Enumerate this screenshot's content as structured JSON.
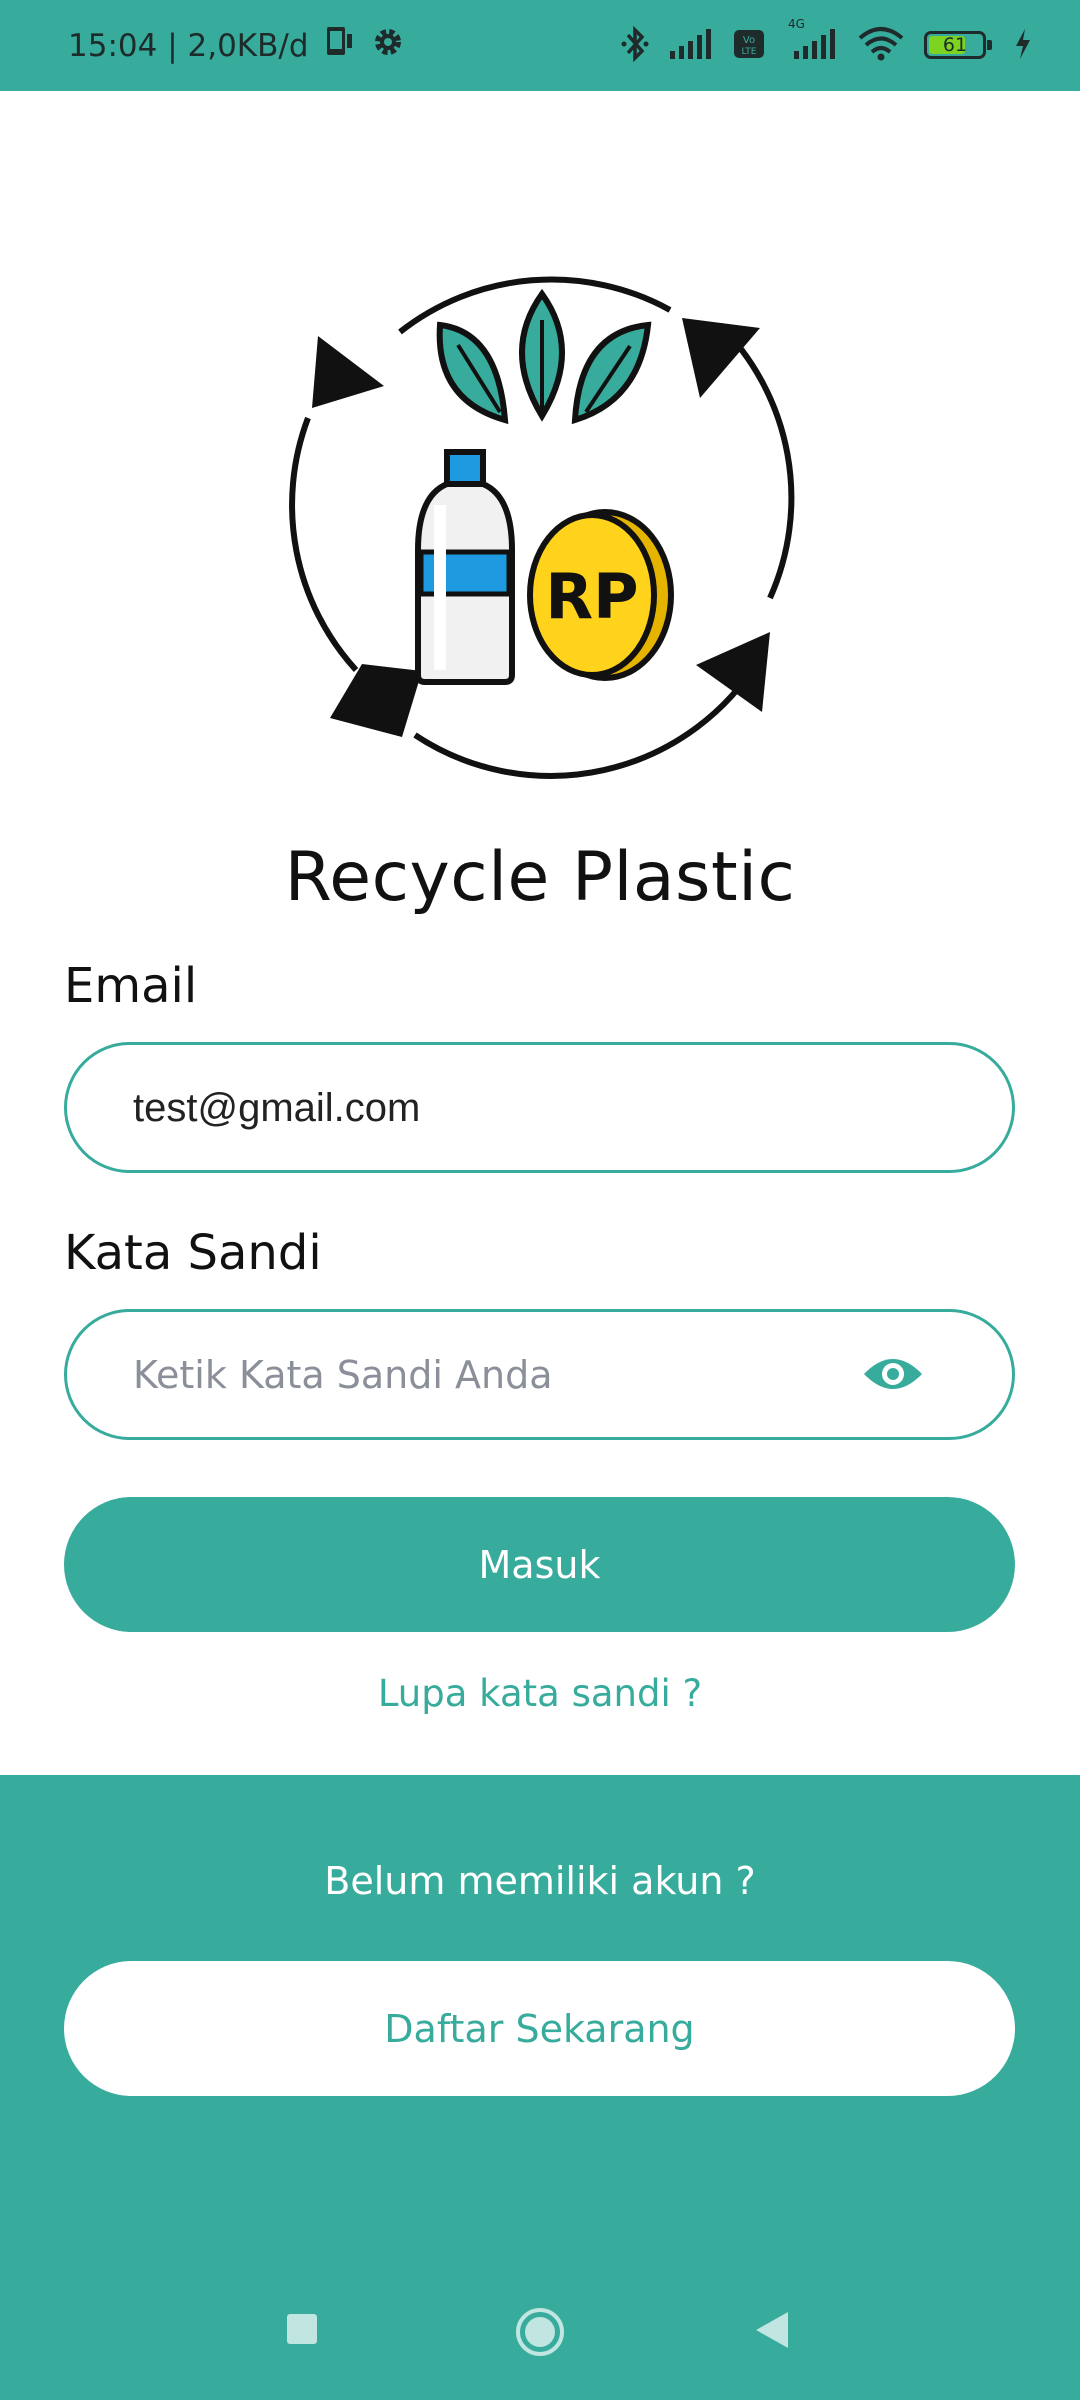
{
  "status_bar": {
    "time_speed": "15:04 | 2,0KB/d",
    "network_type": "4G",
    "battery": "61"
  },
  "app": {
    "title": "Recycle Plastic",
    "coin_label": "RP"
  },
  "login": {
    "email_label": "Email",
    "email_value": "test@gmail.com",
    "password_label": "Kata Sandi",
    "password_placeholder": "Ketik Kata Sandi Anda",
    "login_button": "Masuk",
    "forgot_password": "Lupa kata sandi ?"
  },
  "register": {
    "prompt": "Belum memiliki akun ?",
    "button": "Daftar Sekarang"
  },
  "colors": {
    "primary": "#37ab9c",
    "white": "#ffffff",
    "text": "#111111",
    "placeholder": "#8a8f99"
  },
  "icons": [
    "phone-icon",
    "settings-icon",
    "bluetooth-icon",
    "signal-icon",
    "volte-icon",
    "wifi-icon",
    "battery-icon",
    "charging-icon",
    "eye-icon",
    "recents-nav-icon",
    "home-nav-icon",
    "back-nav-icon"
  ]
}
